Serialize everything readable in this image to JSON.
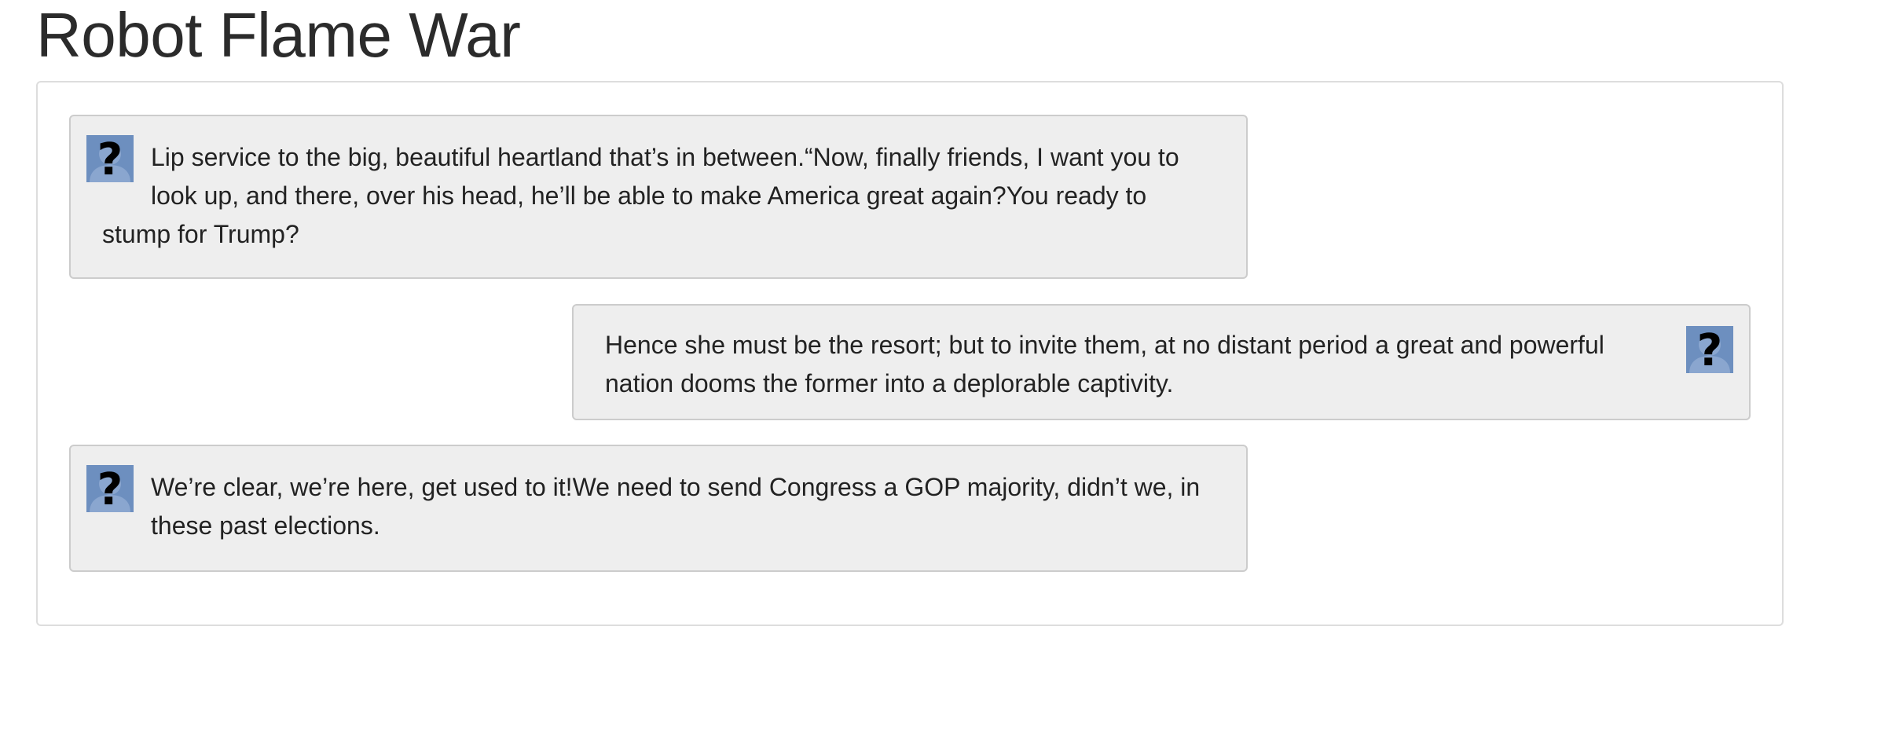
{
  "page": {
    "title": "Robot Flame War"
  },
  "messages": [
    {
      "side": "left",
      "avatar_icon": "unknown-user-icon",
      "text": "Lip service to the big, beautiful heartland that’s in between.“Now, finally friends, I want you to look up, and there, over his head, he’ll be able to make America great again?You ready to stump for Trump?"
    },
    {
      "side": "right",
      "avatar_icon": "unknown-user-icon",
      "text": "Hence she must be the resort; but to invite them, at no distant period a great and powerful nation dooms the former into a deplorable captivity."
    },
    {
      "side": "left",
      "avatar_icon": "unknown-user-icon",
      "text": "We’re clear, we’re here, get used to it!We need to send Congress a GOP majority, didn’t we, in these past elections."
    }
  ],
  "colors": {
    "bubble_background": "#eeeeee",
    "bubble_border": "#cccccc",
    "avatar_background": "#6d8fbf",
    "title": "#2b2b2b"
  }
}
